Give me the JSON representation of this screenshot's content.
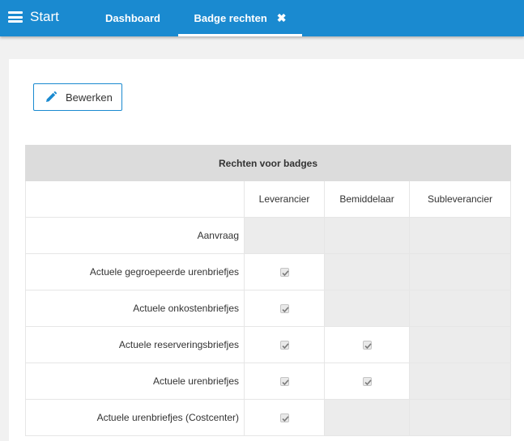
{
  "topbar": {
    "start_label": "Start",
    "tabs": [
      {
        "label": "Dashboard",
        "active": false
      },
      {
        "label": "Badge rechten",
        "active": true,
        "closable": true
      }
    ],
    "accent": "#1a8ad0"
  },
  "toolbar": {
    "edit_label": "Bewerken",
    "edit_icon": "pencil-icon"
  },
  "permissions": {
    "title": "Rechten voor badges",
    "columns": [
      "Leverancier",
      "Bemiddelaar",
      "Subleverancier"
    ],
    "rows": [
      {
        "label": "Aanvraag",
        "cells": [
          "disabled",
          "disabled",
          "disabled"
        ]
      },
      {
        "label": "Actuele gegroepeerde urenbriefjes",
        "cells": [
          "checked",
          "disabled",
          "disabled"
        ]
      },
      {
        "label": "Actuele onkostenbriefjes",
        "cells": [
          "checked",
          "disabled",
          "disabled"
        ]
      },
      {
        "label": "Actuele reserveringsbriefjes",
        "cells": [
          "checked",
          "checked",
          "disabled"
        ]
      },
      {
        "label": "Actuele urenbriefjes",
        "cells": [
          "checked",
          "checked",
          "disabled"
        ]
      },
      {
        "label": "Actuele urenbriefjes (Costcenter)",
        "cells": [
          "checked",
          "disabled",
          "disabled"
        ]
      }
    ]
  }
}
